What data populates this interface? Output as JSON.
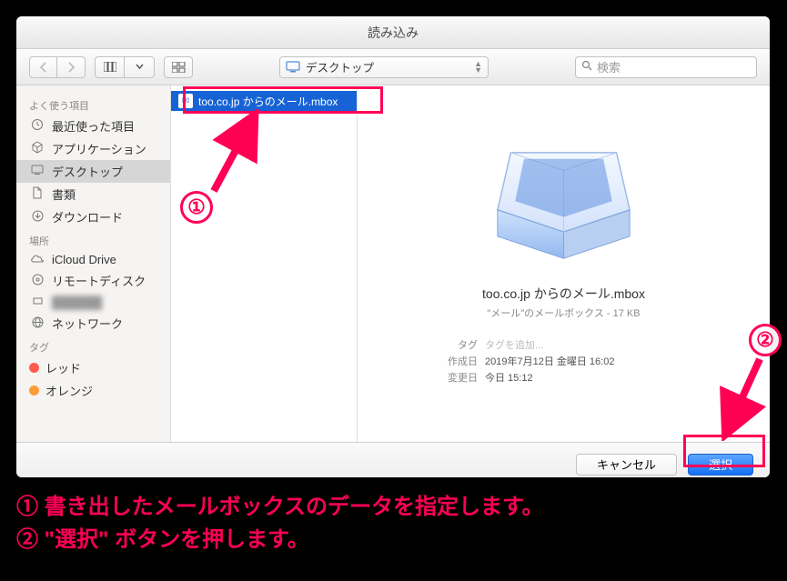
{
  "window": {
    "title": "読み込み"
  },
  "toolbar": {
    "path_location": "デスクトップ",
    "search_placeholder": "検索"
  },
  "sidebar": {
    "favorites_header": "よく使う項目",
    "favorites": [
      {
        "label": "最近使った項目",
        "icon": "clock-icon"
      },
      {
        "label": "アプリケーション",
        "icon": "apps-icon"
      },
      {
        "label": "デスクトップ",
        "icon": "desktop-icon",
        "selected": true
      },
      {
        "label": "書類",
        "icon": "documents-icon"
      },
      {
        "label": "ダウンロード",
        "icon": "downloads-icon"
      }
    ],
    "locations_header": "場所",
    "locations": [
      {
        "label": "iCloud Drive",
        "icon": "icloud-icon"
      },
      {
        "label": "リモートディスク",
        "icon": "remote-disc-icon"
      },
      {
        "label": "",
        "icon": "generic-icon",
        "blurred": true
      },
      {
        "label": "ネットワーク",
        "icon": "network-icon"
      }
    ],
    "tags_header": "タグ",
    "tags": [
      {
        "label": "レッド",
        "color": "#ff5b4f"
      },
      {
        "label": "オレンジ",
        "color": "#ff9c3a"
      }
    ]
  },
  "filelist": {
    "selected_file": "too.co.jp からのメール.mbox"
  },
  "preview": {
    "filename": "too.co.jp からのメール.mbox",
    "subtitle": "\"メール\"のメールボックス - 17 KB",
    "meta": {
      "tag_label": "タグ",
      "tag_value": "タグを追加...",
      "created_label": "作成日",
      "created_value": "2019年7月12日 金曜日 16:02",
      "modified_label": "変更日",
      "modified_value": "今日 15:12"
    }
  },
  "footer": {
    "cancel": "キャンセル",
    "choose": "選択"
  },
  "annotations": {
    "marker1": "①",
    "marker2": "②",
    "instruction1": "① 書き出したメールボックスのデータを指定します。",
    "instruction2": "② \"選択\" ボタンを押します。"
  }
}
